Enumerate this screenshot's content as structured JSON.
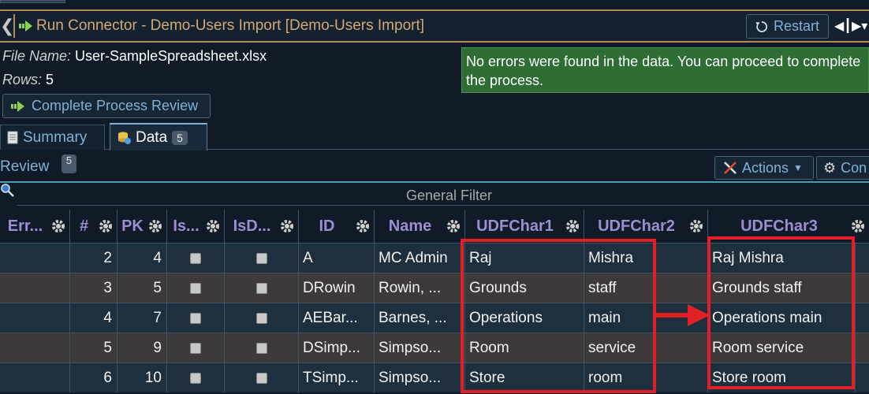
{
  "header": {
    "title": "Run Connector - Demo-Users Import [Demo-Users Import]",
    "restart_label": "Restart"
  },
  "info": {
    "file_label": "File Name:",
    "file_value": "User-SampleSpreadsheet.xlsx",
    "rows_label": "Rows:",
    "rows_value": "5"
  },
  "alert": {
    "text": "No errors were found in the data. You can proceed to complete the process."
  },
  "complete_button": "Complete Process Review",
  "tabs": [
    {
      "label": "Summary"
    },
    {
      "label": "Data",
      "badge": "5"
    }
  ],
  "review": {
    "label": "Review",
    "badge": "5",
    "actions_label": "Actions",
    "config_label": "Con"
  },
  "filter": {
    "label": "General Filter"
  },
  "grid": {
    "columns": [
      "Err...",
      "#",
      "PK",
      "Is...",
      "IsD...",
      "ID",
      "Name",
      "UDFChar1",
      "UDFChar2",
      "UDFChar3"
    ],
    "rows": [
      {
        "num": "2",
        "pk": "4",
        "id": "A",
        "name": "MC Admin",
        "udf1": "Raj",
        "udf2": "Mishra",
        "udf3": "Raj Mishra"
      },
      {
        "num": "3",
        "pk": "5",
        "id": "DRowin",
        "name": "Rowin, ...",
        "udf1": "Grounds",
        "udf2": "staff",
        "udf3": "Grounds staff"
      },
      {
        "num": "4",
        "pk": "7",
        "id": "AEBar...",
        "name": "Barnes, ...",
        "udf1": "Operations",
        "udf2": "main",
        "udf3": "Operations main"
      },
      {
        "num": "5",
        "pk": "9",
        "id": "DSimp...",
        "name": "Simpso...",
        "udf1": "Room",
        "udf2": "service",
        "udf3": "Room service"
      },
      {
        "num": "6",
        "pk": "10",
        "id": "TSimp...",
        "name": "Simpso...",
        "udf1": "Store",
        "udf2": "room",
        "udf3": "Store room"
      }
    ]
  },
  "colors": {
    "row_teal": "#1e2f3d",
    "row_brown": "#3e3a3a",
    "highlight_red": "#e21f26",
    "header_text": "#9b8fd1"
  }
}
